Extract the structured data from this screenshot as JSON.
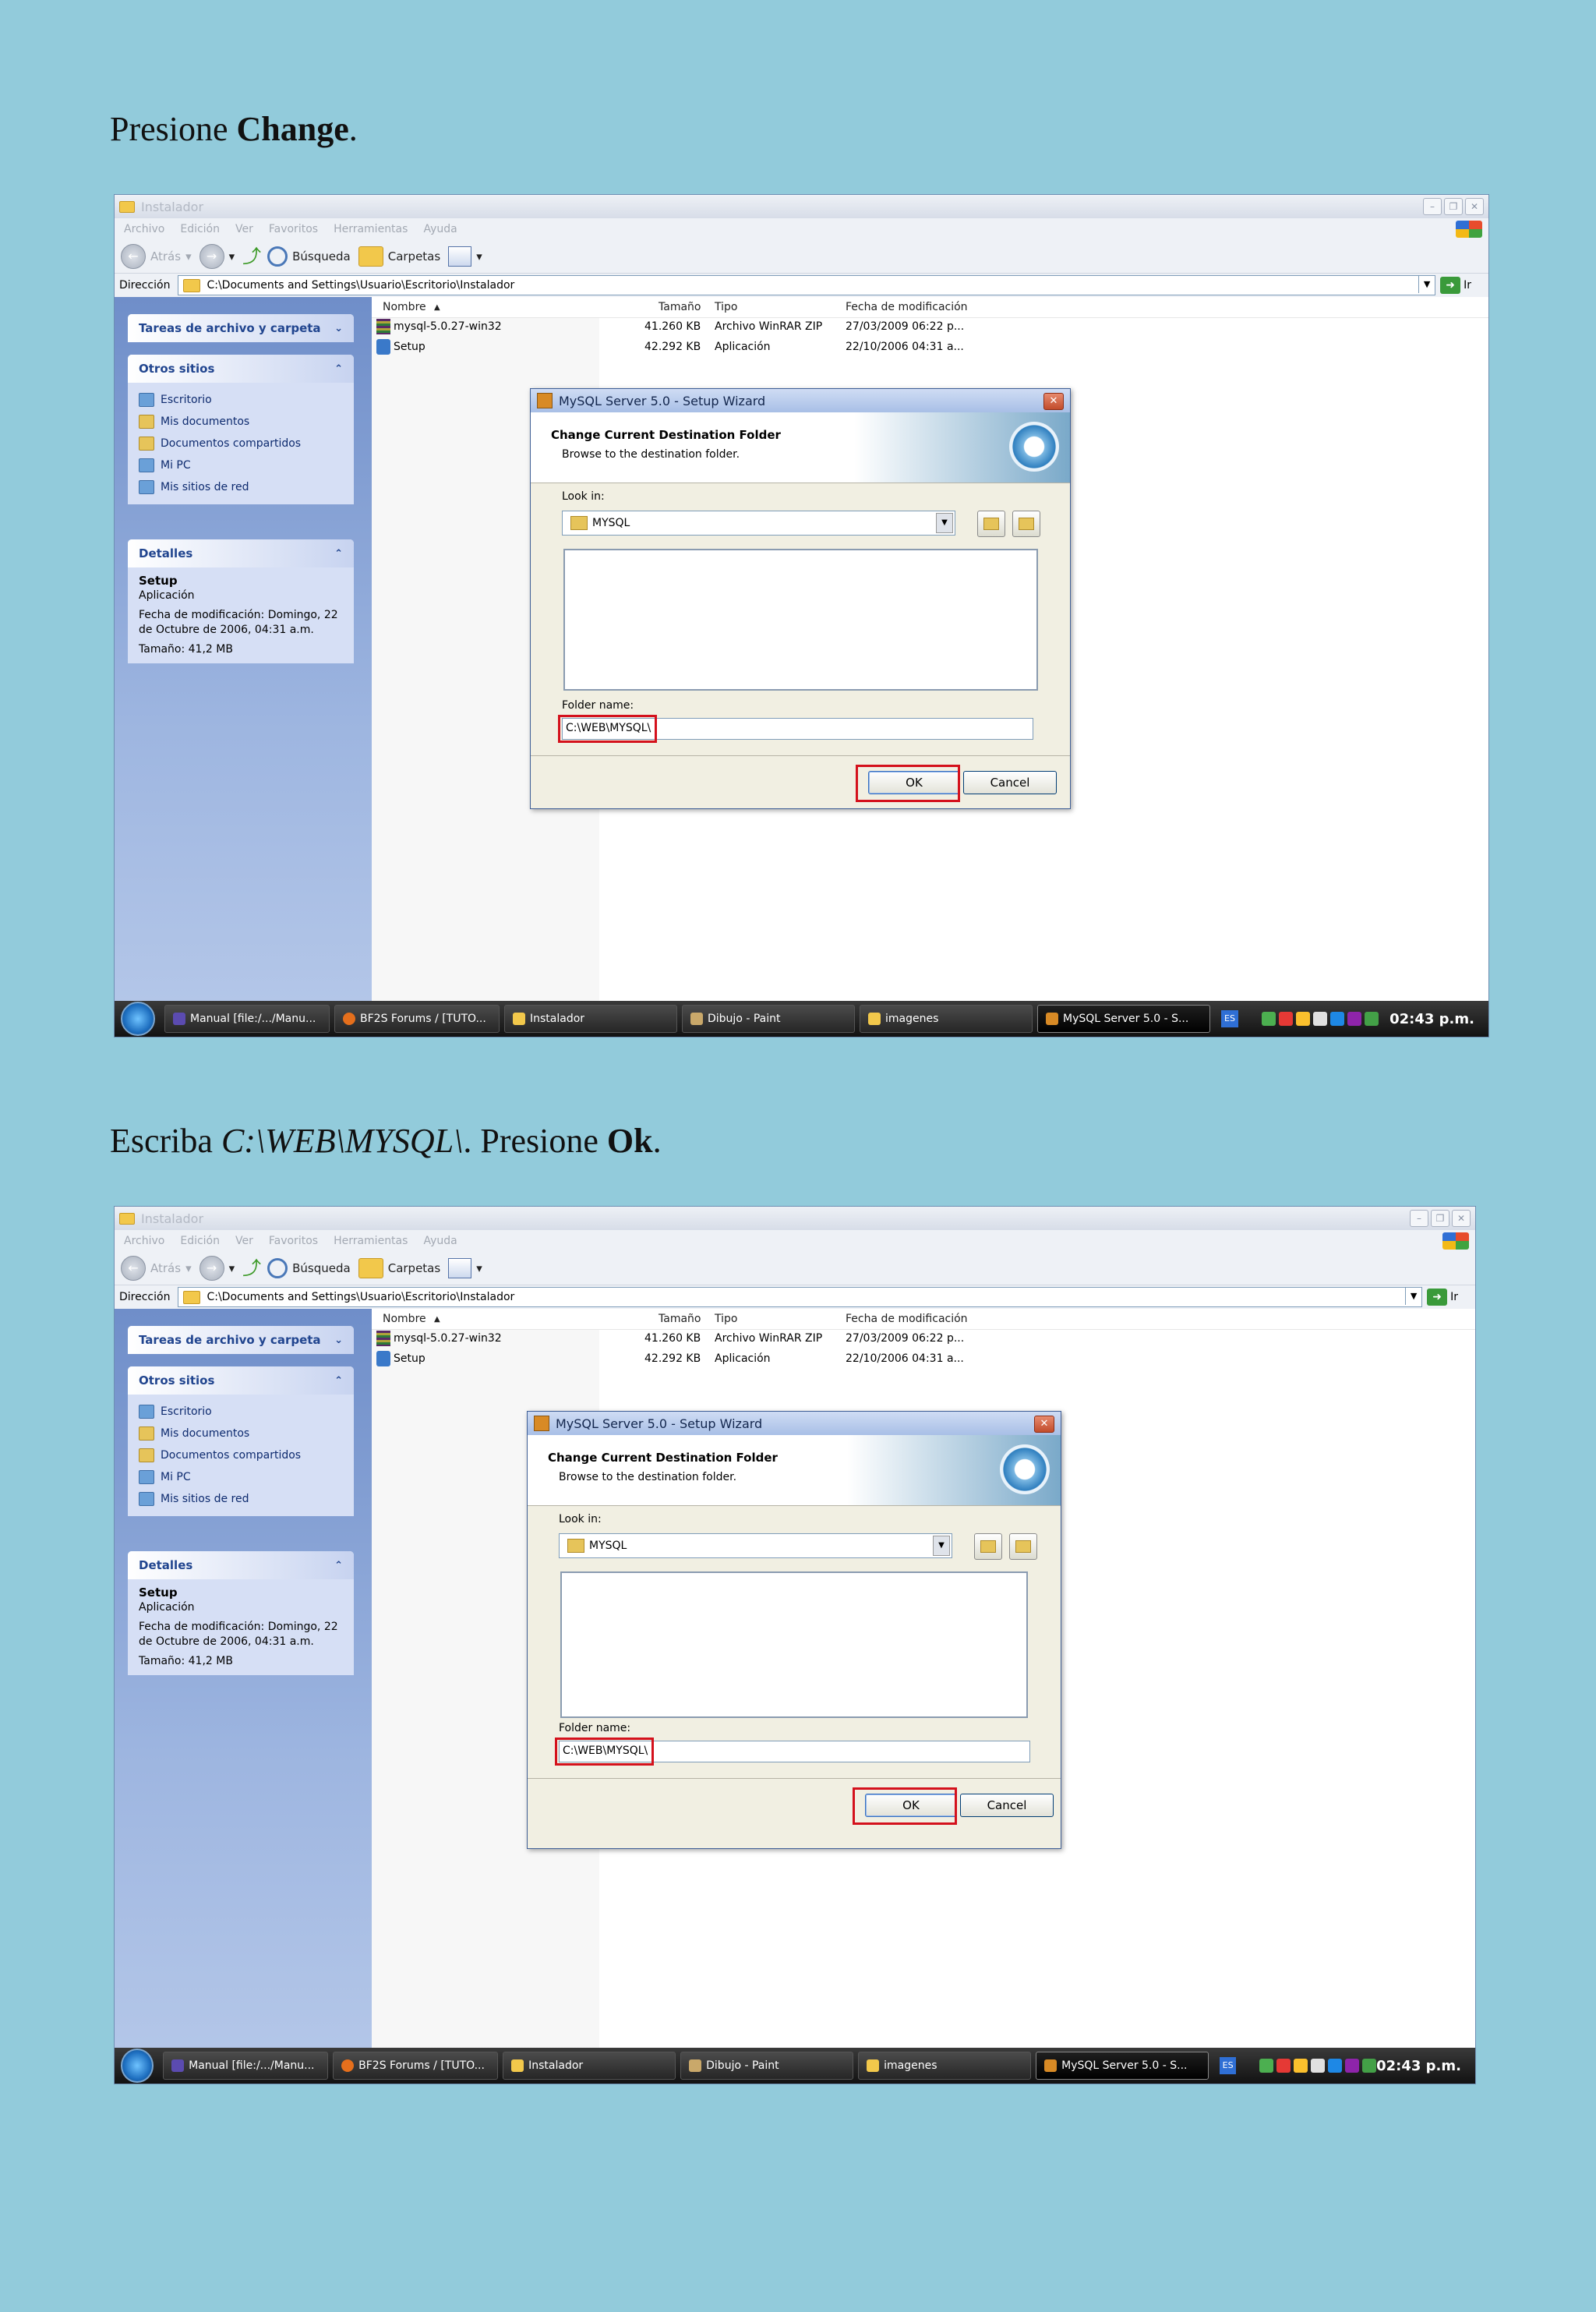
{
  "captions": [
    {
      "prefix": "Presione ",
      "bold": "Change",
      "suffix": "."
    },
    {
      "prefix": "Escriba ",
      "italic": "C:\\WEB\\MYSQL\\",
      "middle": ". Presione ",
      "bold": "Ok",
      "suffix": "."
    }
  ],
  "explorer": {
    "title": "Instalador",
    "menu": [
      "Archivo",
      "Edición",
      "Ver",
      "Favoritos",
      "Herramientas",
      "Ayuda"
    ],
    "toolbar": {
      "back": "Atrás",
      "search": "Búsqueda",
      "folders": "Carpetas"
    },
    "address_label": "Dirección",
    "address": "C:\\Documents and Settings\\Usuario\\Escritorio\\Instalador",
    "go_label": "Ir",
    "tasks_title": "Tareas de archivo y carpeta",
    "other_places_title": "Otros sitios",
    "other_places": [
      "Escritorio",
      "Mis documentos",
      "Documentos compartidos",
      "Mi PC",
      "Mis sitios de red"
    ],
    "details_title": "Detalles",
    "details_name": "Setup",
    "details_type": "Aplicación",
    "details_modified": "Fecha de modificación: Domingo, 22 de Octubre de 2006, 04:31 a.m.",
    "details_size": "Tamaño: 41,2 MB",
    "columns": [
      "Nombre",
      "Tamaño",
      "Tipo",
      "Fecha de modificación"
    ],
    "files": [
      {
        "name": "mysql-5.0.27-win32",
        "size": "41.260 KB",
        "type": "Archivo WinRAR ZIP",
        "date": "27/03/2009 06:22 p..."
      },
      {
        "name": "Setup",
        "size": "42.292 KB",
        "type": "Aplicación",
        "date": "22/10/2006 04:31 a..."
      }
    ]
  },
  "dialog": {
    "title": "MySQL Server 5.0 - Setup Wizard",
    "heading": "Change Current Destination Folder",
    "subheading": "Browse to the destination folder.",
    "look_in_label": "Look in:",
    "look_in_value": "MYSQL",
    "folder_name_label": "Folder name:",
    "folder_name_value": "C:\\WEB\\MYSQL\\",
    "ok_label": "OK",
    "cancel_label": "Cancel"
  },
  "taskbar": {
    "tasks": [
      "Manual [file:/.../Manu...",
      "BF2S Forums / [TUTO...",
      "Instalador",
      "Dibujo - Paint",
      "imagenes",
      "MySQL Server 5.0 - S..."
    ],
    "lang": "ES",
    "clock": "02:43 p.m."
  }
}
